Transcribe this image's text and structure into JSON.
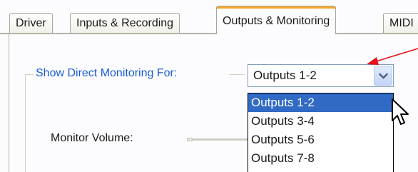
{
  "tabs": [
    {
      "label": "Driver",
      "active": false
    },
    {
      "label": "Inputs & Recording",
      "active": false
    },
    {
      "label": "Outputs & Monitoring",
      "active": true
    },
    {
      "label": "MIDI",
      "active": false
    }
  ],
  "group": {
    "label": "Show Direct Monitoring For:",
    "color": "#1a5bd6"
  },
  "combo": {
    "value": "Outputs 1-2",
    "options": [
      "Outputs 1-2",
      "Outputs 3-4",
      "Outputs 5-6",
      "Outputs 7-8"
    ],
    "selected_index": 0,
    "open": true
  },
  "monitor": {
    "label": "Monitor Volume:"
  },
  "annotation": {
    "arrow_color": "#e3141a"
  },
  "colors": {
    "selection": "#316ac5",
    "active_tab_accent": "#f6a82c"
  },
  "icons": [
    "chevron-down-icon",
    "pointer-cursor-icon",
    "red-arrow-annotation"
  ]
}
